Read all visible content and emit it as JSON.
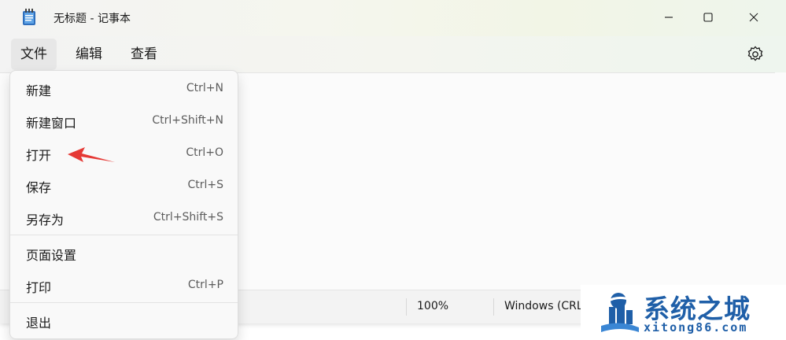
{
  "window": {
    "title": "无标题 - 记事本",
    "icon": "notepad-icon"
  },
  "menubar": {
    "file": "文件",
    "edit": "编辑",
    "view": "查看",
    "settings_icon": "gear-icon"
  },
  "file_menu": {
    "items": [
      {
        "label": "新建",
        "shortcut": "Ctrl+N"
      },
      {
        "label": "新建窗口",
        "shortcut": "Ctrl+Shift+N"
      },
      {
        "label": "打开",
        "shortcut": "Ctrl+O"
      },
      {
        "label": "保存",
        "shortcut": "Ctrl+S"
      },
      {
        "label": "另存为",
        "shortcut": "Ctrl+Shift+S"
      },
      {
        "label": "页面设置",
        "shortcut": ""
      },
      {
        "label": "打印",
        "shortcut": "Ctrl+P"
      },
      {
        "label": "退出",
        "shortcut": ""
      }
    ]
  },
  "statusbar": {
    "zoom": "100%",
    "encoding": "Windows (CRL"
  },
  "annotation": {
    "arrow_color": "#e53935"
  },
  "watermark": {
    "title": "系统之城",
    "subtitle": "xitong86.com",
    "color": "#1f5fa8"
  }
}
